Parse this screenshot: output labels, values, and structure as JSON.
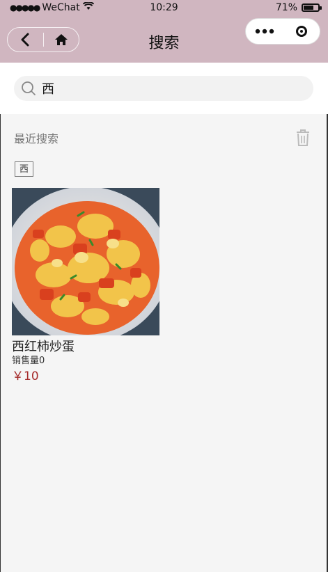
{
  "status_bar": {
    "carrier": "WeChat",
    "time": "10:29",
    "battery": "71%",
    "battery_level": 0.71
  },
  "nav": {
    "title": "搜索"
  },
  "search": {
    "value": "西"
  },
  "recent": {
    "label": "最近搜索",
    "tags": [
      "西"
    ]
  },
  "results": [
    {
      "name": "西红柿炒蛋",
      "sales": "销售量0",
      "price": "￥10"
    }
  ],
  "colors": {
    "nav_bg": "#d0b6c0",
    "price": "#a52a2a",
    "page_bg": "#f5f5f5"
  }
}
